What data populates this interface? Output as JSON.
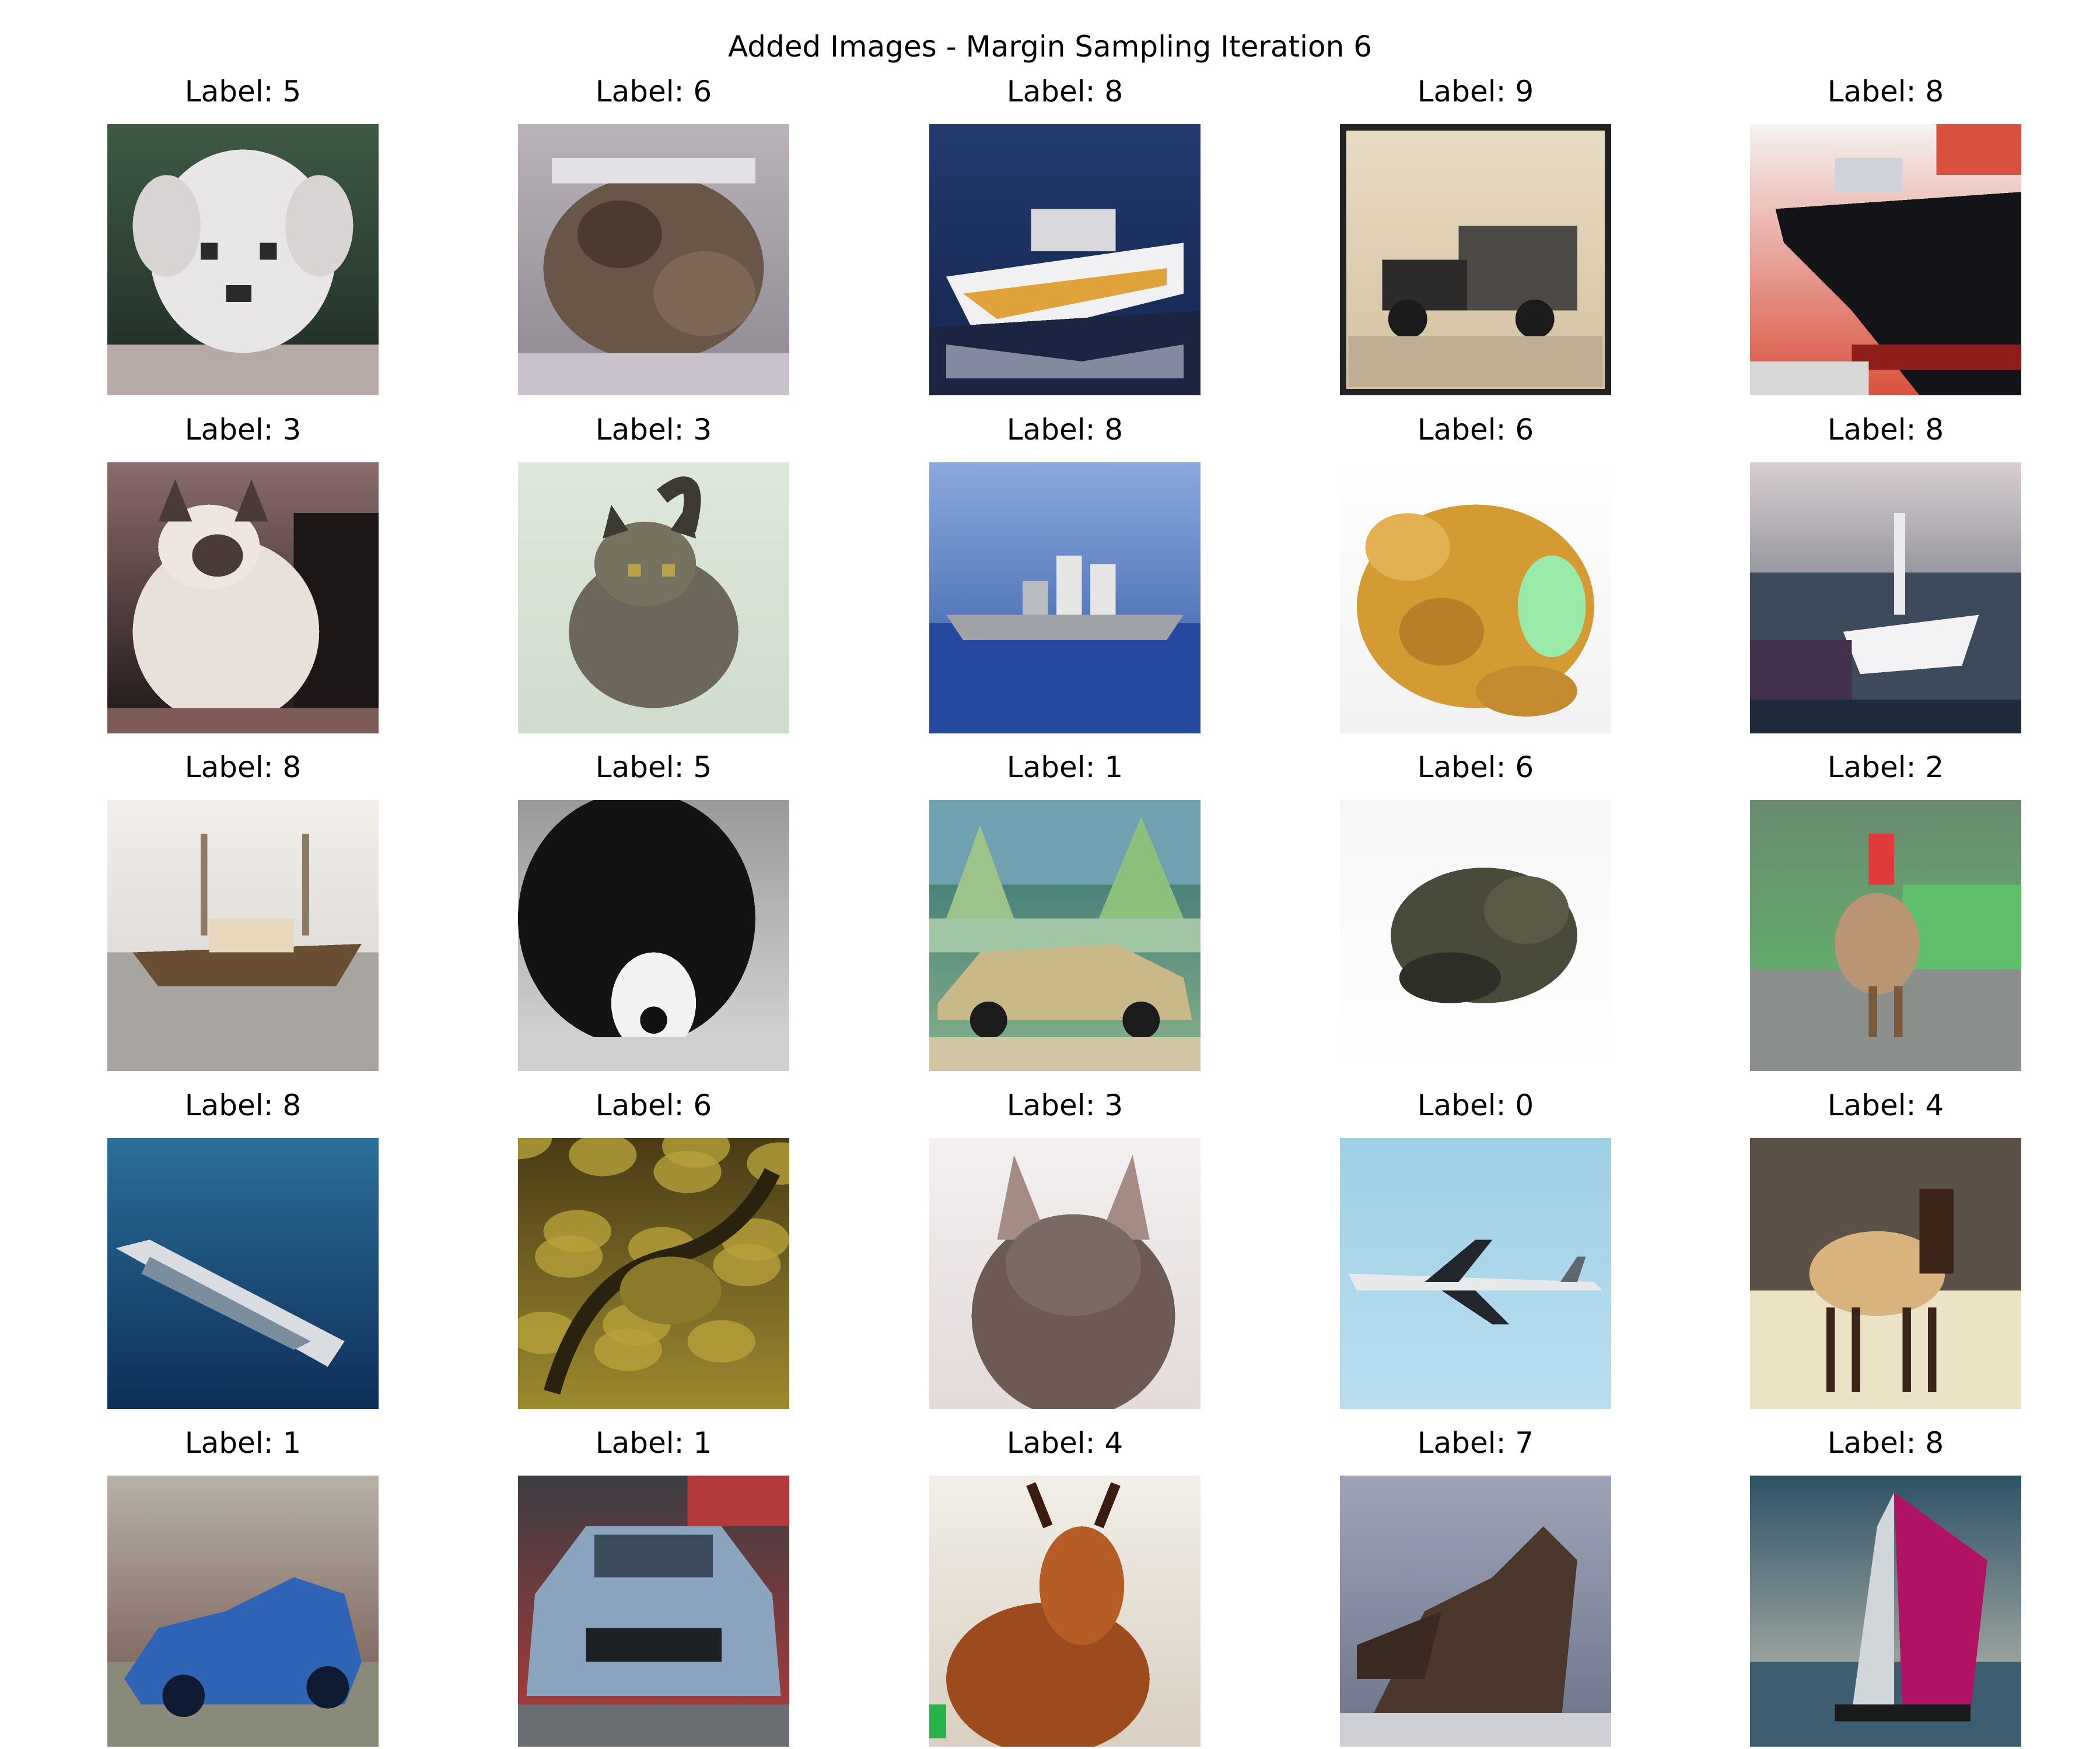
{
  "figure": {
    "title": "Added Images - Margin Sampling Iteration 6"
  },
  "cells": [
    {
      "label": "Label: 5",
      "subject": "white-puppy",
      "colors": {
        "bg": "#3f5a45",
        "bg2": "#1e2a24",
        "main": "#e8e6e6",
        "accent": "#2a2a2a",
        "ground": "#b7a9a6"
      }
    },
    {
      "label": "Label: 6",
      "subject": "frog-on-rock",
      "colors": {
        "bg": "#b9b3b9",
        "bg2": "#8e8790",
        "main": "#6a5648",
        "accent": "#4a3a30",
        "ground": "#c9c2cc"
      }
    },
    {
      "label": "Label: 8",
      "subject": "speedboat",
      "colors": {
        "bg": "#223a6e",
        "bg2": "#16264d",
        "main": "#f1f0f2",
        "accent": "#e0a23a",
        "ground": "#1b2440"
      }
    },
    {
      "label": "Label: 9",
      "subject": "old-truck-photo",
      "colors": {
        "bg": "#e9dcc5",
        "bg2": "#d3c1a0",
        "main": "#4d4a45",
        "accent": "#2d2b29",
        "ground": "#bfae93"
      }
    },
    {
      "label": "Label: 8",
      "subject": "cargo-ship",
      "colors": {
        "bg": "#f5f3f2",
        "bg2": "#d9513e",
        "main": "#141418",
        "accent": "#8f1d1a",
        "ground": "#d8d9d6"
      }
    },
    {
      "label": "Label: 3",
      "subject": "siamese-cat",
      "colors": {
        "bg": "#8b6c6c",
        "bg2": "#1d1616",
        "main": "#e9e1d9",
        "accent": "#4b3b38",
        "ground": "#7c5a55"
      }
    },
    {
      "label": "Label: 3",
      "subject": "tabby-cat",
      "colors": {
        "bg": "#dfe8da",
        "bg2": "#cfdccd",
        "main": "#6c665b",
        "accent": "#3d3a34",
        "ground": "#d9e4d5"
      }
    },
    {
      "label": "Label: 8",
      "subject": "warship-at-sea",
      "colors": {
        "bg": "#8aa9dd",
        "bg2": "#2e55a2",
        "main": "#9fa3a8",
        "accent": "#e6e6e6",
        "ground": "#2649a0"
      }
    },
    {
      "label": "Label: 6",
      "subject": "orange-frog",
      "colors": {
        "bg": "#ffffff",
        "bg2": "#f2f2f2",
        "main": "#d49a34",
        "accent": "#9aeaa9",
        "ground": "#e9e9e9"
      }
    },
    {
      "label": "Label: 8",
      "subject": "white-boat",
      "colors": {
        "bg": "#d8cfd0",
        "bg2": "#3c4a5c",
        "main": "#f3f3f6",
        "accent": "#1f2a3a",
        "ground": "#43304a"
      }
    },
    {
      "label": "Label: 8",
      "subject": "wooden-boat",
      "colors": {
        "bg": "#f1eeea",
        "bg2": "#d6d3cf",
        "main": "#6a4e33",
        "accent": "#e6d7bd",
        "ground": "#a8a49f"
      }
    },
    {
      "label": "Label: 5",
      "subject": "black-white-dog",
      "colors": {
        "bg": "#9a9a9a",
        "bg2": "#d8d8d8",
        "main": "#131313",
        "accent": "#f2f2f2",
        "ground": "#cfcfcf"
      }
    },
    {
      "label": "Label: 1",
      "subject": "tan-car-trees",
      "colors": {
        "bg": "#2f6b73",
        "bg2": "#87b38a",
        "main": "#c9b888",
        "accent": "#1c1c1c",
        "ground": "#d2c6a4"
      }
    },
    {
      "label": "Label: 6",
      "subject": "toad-white-bg",
      "colors": {
        "bg": "#f7f7f7",
        "bg2": "#ffffff",
        "main": "#4a4a3b",
        "accent": "#2f2f27",
        "ground": "#efefef"
      }
    },
    {
      "label": "Label: 2",
      "subject": "rooster-grass",
      "colors": {
        "bg": "#6a8a70",
        "bg2": "#5fbf6a",
        "main": "#b99573",
        "accent": "#e03a3a",
        "ground": "#8a8f8c"
      }
    },
    {
      "label": "Label: 8",
      "subject": "ship-aerial",
      "colors": {
        "bg": "#2b6f99",
        "bg2": "#0d2e57",
        "main": "#d9dde2",
        "accent": "#7b8ea0",
        "ground": "#134570"
      }
    },
    {
      "label": "Label: 6",
      "subject": "camouflaged-frog",
      "colors": {
        "bg": "#4a3b16",
        "bg2": "#9c8a2f",
        "main": "#b7a13a",
        "accent": "#2a220e",
        "ground": "#6b5a22"
      }
    },
    {
      "label": "Label: 3",
      "subject": "fluffy-cat",
      "colors": {
        "bg": "#f3eff0",
        "bg2": "#e4dada",
        "main": "#6e5a55",
        "accent": "#a48b83",
        "ground": "#e9e3e4"
      }
    },
    {
      "label": "Label: 0",
      "subject": "airplane-sky",
      "colors": {
        "bg": "#9fd0e6",
        "bg2": "#b9def0",
        "main": "#e7e9ec",
        "accent": "#22272d",
        "ground": "#a9d8ec"
      }
    },
    {
      "label": "Label: 4",
      "subject": "elk-forest",
      "colors": {
        "bg": "#5c5147",
        "bg2": "#3b332d",
        "main": "#d9b37e",
        "accent": "#3d2418",
        "ground": "#ece3c7"
      }
    },
    {
      "label": "Label: 1",
      "subject": "blue-sports-car",
      "colors": {
        "bg": "#b8b2a6",
        "bg2": "#6b4c47",
        "main": "#2f63b6",
        "accent": "#0f1b33",
        "ground": "#8a8a7a"
      }
    },
    {
      "label": "Label: 1",
      "subject": "grey-sedan",
      "colors": {
        "bg": "#3b3d42",
        "bg2": "#b23a3a",
        "main": "#8aa4c0",
        "accent": "#1c1f24",
        "ground": "#6b6e73"
      }
    },
    {
      "label": "Label: 4",
      "subject": "deer-closeup",
      "colors": {
        "bg": "#f2efe8",
        "bg2": "#d9cfc1",
        "main": "#9c4a1e",
        "accent": "#3a1d10",
        "ground": "#d6d1c9"
      }
    },
    {
      "label": "Label: 7",
      "subject": "horse-head",
      "colors": {
        "bg": "#9ea3b8",
        "bg2": "#6c7388",
        "main": "#4b372b",
        "accent": "#1f1a17",
        "ground": "#cfcfd6"
      }
    },
    {
      "label": "Label: 8",
      "subject": "pink-sailboat",
      "colors": {
        "bg": "#2e5266",
        "bg2": "#c9c6b7",
        "main": "#b01363",
        "accent": "#d0d6d9",
        "ground": "#3d5d70"
      }
    }
  ]
}
